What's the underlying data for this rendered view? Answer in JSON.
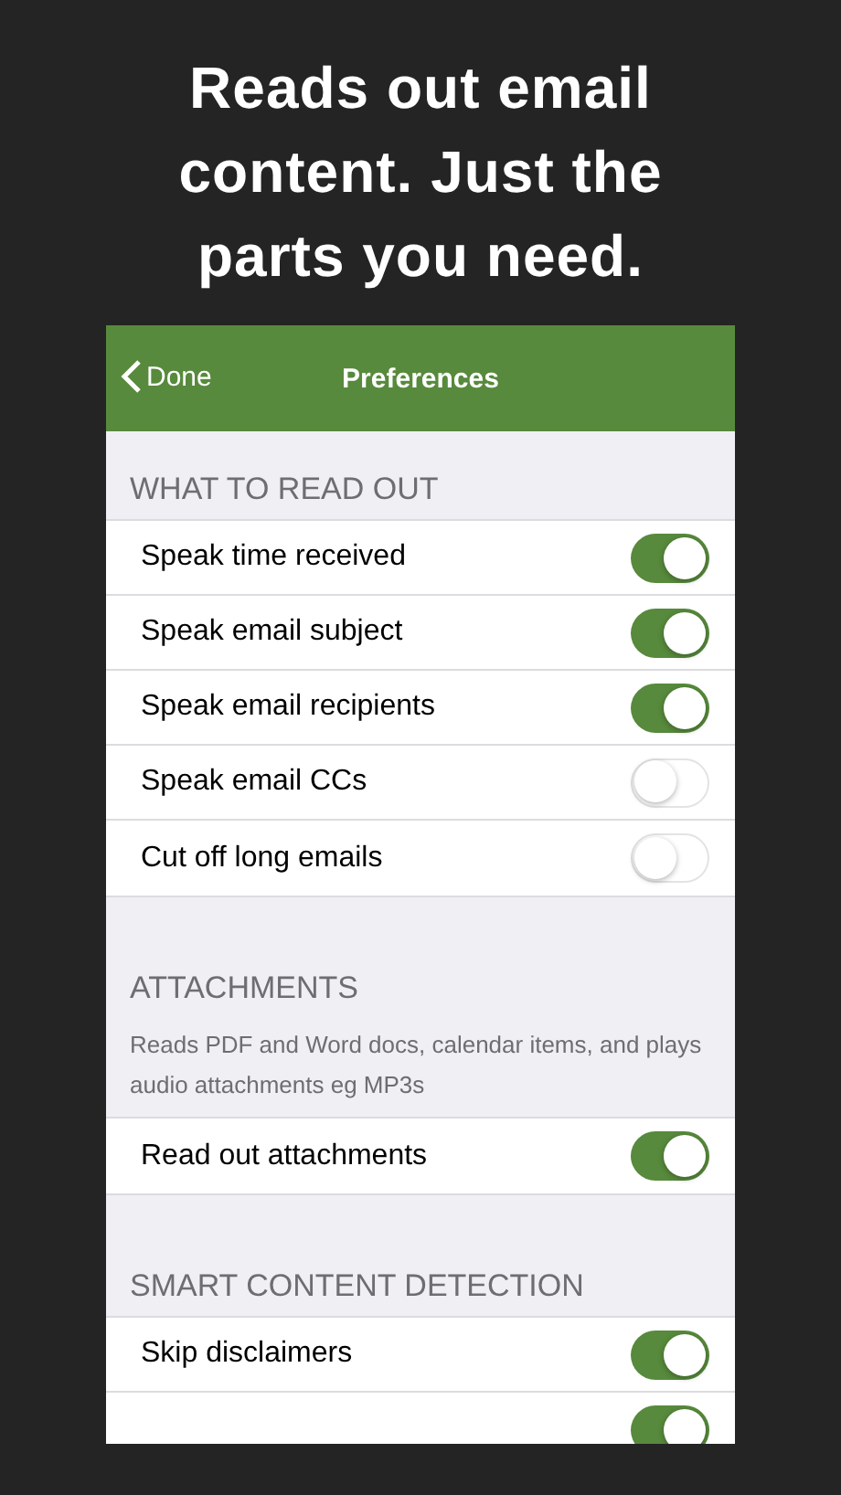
{
  "headline_lines": [
    "Reads out email",
    "content. Just the",
    "parts you need."
  ],
  "nav": {
    "back": "Done",
    "title": "Preferences"
  },
  "sections": [
    {
      "header": "WHAT TO READ OUT",
      "rows": [
        {
          "label": "Speak time received",
          "on": true
        },
        {
          "label": "Speak email subject",
          "on": true
        },
        {
          "label": "Speak email recipients",
          "on": true
        },
        {
          "label": "Speak email CCs",
          "on": false
        },
        {
          "label": "Cut off long emails",
          "on": false
        }
      ]
    },
    {
      "header": "ATTACHMENTS",
      "description": "Reads PDF and Word docs, calendar items, and plays audio attachments eg MP3s",
      "rows": [
        {
          "label": "Read out attachments",
          "on": true
        }
      ]
    },
    {
      "header": "SMART CONTENT DETECTION",
      "rows": [
        {
          "label": "Skip disclaimers",
          "on": true
        },
        {
          "on": true
        }
      ]
    }
  ]
}
